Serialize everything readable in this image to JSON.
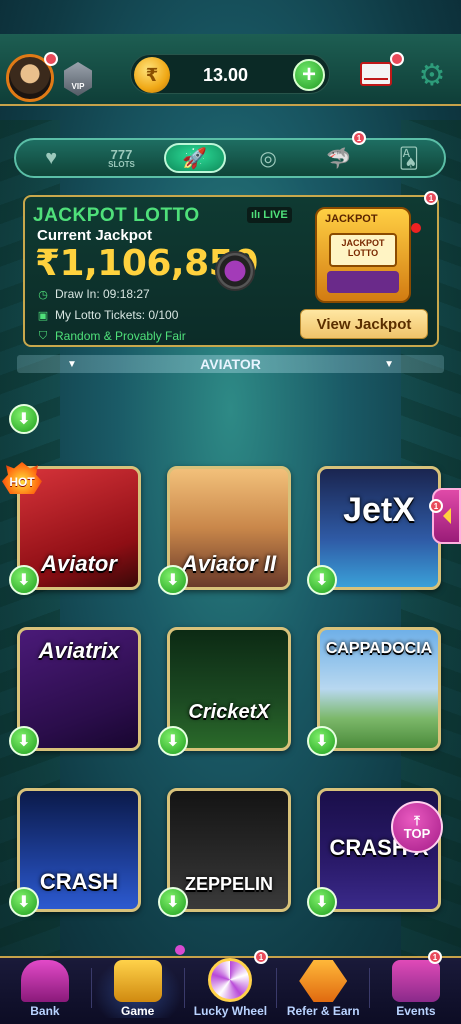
{
  "header": {
    "vip_label": "VIP",
    "balance": "13.00",
    "coin_symbol": "₹",
    "plus_label": "+"
  },
  "tabs": [
    {
      "id": "favorites",
      "icon": "heart-icon",
      "glyph": "♥"
    },
    {
      "id": "slots",
      "icon": "slots-icon",
      "top": "777",
      "label": "SLOTS"
    },
    {
      "id": "crash",
      "icon": "rocket-icon",
      "glyph": "🚀",
      "active": true
    },
    {
      "id": "live",
      "icon": "roulette-icon",
      "glyph": "◎"
    },
    {
      "id": "fishing",
      "icon": "shark-icon",
      "glyph": "🦈"
    },
    {
      "id": "cards",
      "icon": "cards-icon",
      "glyph": "🂡"
    }
  ],
  "jackpot": {
    "title": "JACKPOT LOTTO",
    "live_label": "LIVE",
    "current_label": "Current Jackpot",
    "value": "₹1,106,850",
    "draw_in": "Draw In: 09:18:27",
    "tickets": "My Lotto Tickets: 0/100",
    "fair": "Random & Provably Fair",
    "machine_head": "JACKPOT",
    "machine_screen_top": "JACKPOT",
    "machine_screen_bottom": "LOTTO",
    "button": "View Jackpot"
  },
  "section": {
    "title": "AVIATOR"
  },
  "hot_badge": "HOT",
  "games": [
    {
      "id": "aviator",
      "name": "Aviator"
    },
    {
      "id": "aviator2",
      "name": "Aviator II"
    },
    {
      "id": "jetx",
      "name": "JetX"
    },
    {
      "id": "aviatrix",
      "name": "Aviatrix"
    },
    {
      "id": "cricketx",
      "name": "CricketX"
    },
    {
      "id": "cappadocia",
      "name": "CAPPADOCIA"
    },
    {
      "id": "crash",
      "name": "CRASH"
    },
    {
      "id": "zeppelin",
      "name": "ZEPPELIN"
    },
    {
      "id": "crashx",
      "name": "CRASH X"
    }
  ],
  "top_button": "TOP",
  "notifications": {
    "avatar": "",
    "mail": "",
    "tabs": "1",
    "jackpot": "1",
    "side_tab": "1",
    "lucky_wheel": "1",
    "events": "1"
  },
  "bottom_nav": [
    {
      "id": "bank",
      "label": "Bank"
    },
    {
      "id": "game",
      "label": "Game",
      "active": true
    },
    {
      "id": "lucky-wheel",
      "label": "Lucky Wheel"
    },
    {
      "id": "refer",
      "label": "Refer & Earn"
    },
    {
      "id": "events",
      "label": "Events"
    }
  ]
}
